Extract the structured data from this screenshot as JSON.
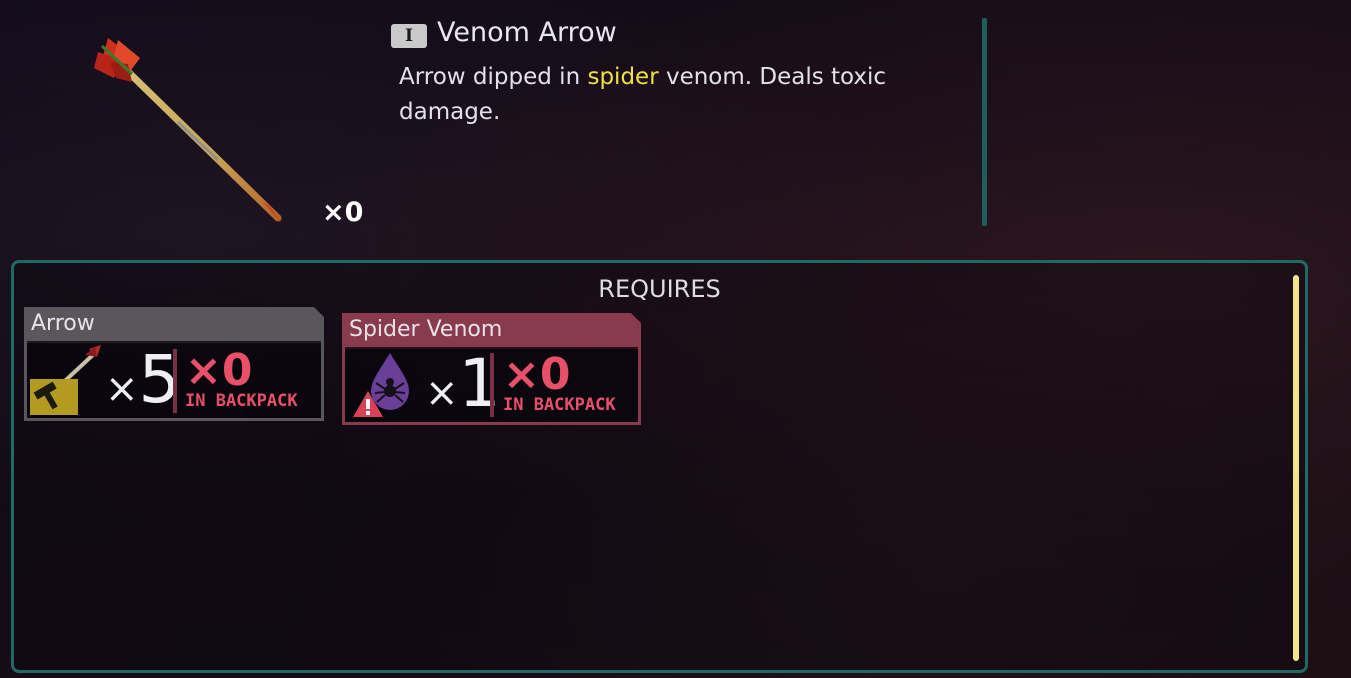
{
  "item": {
    "tier": "I",
    "name": "Venom Arrow",
    "description_parts": [
      "Arrow dipped in ",
      "spider",
      " venom. Deals toxic damage."
    ],
    "highlight_color": "#f1e043",
    "owned_count": "×0",
    "icon": "venom-arrow-icon"
  },
  "requires": {
    "title": "REQUIRES",
    "ingredients": [
      {
        "name": "Arrow",
        "icon": "arrow-icon",
        "badge_icon": "hammer-icon",
        "multiplier_x": "×",
        "multiplier_n": "5",
        "have": "×0",
        "location": "IN BACKPACK",
        "status": "craftable-ingredient"
      },
      {
        "name": "Spider Venom",
        "icon": "spider-venom-icon",
        "badge_icon": "warning-icon",
        "multiplier_x": "×",
        "multiplier_n": "1",
        "have": "×0",
        "location": "IN BACKPACK",
        "status": "missing"
      }
    ]
  },
  "colors": {
    "panel_border": "#1f6a66",
    "missing_red": "#e8506a",
    "scrollbar": "#f3e48f"
  }
}
